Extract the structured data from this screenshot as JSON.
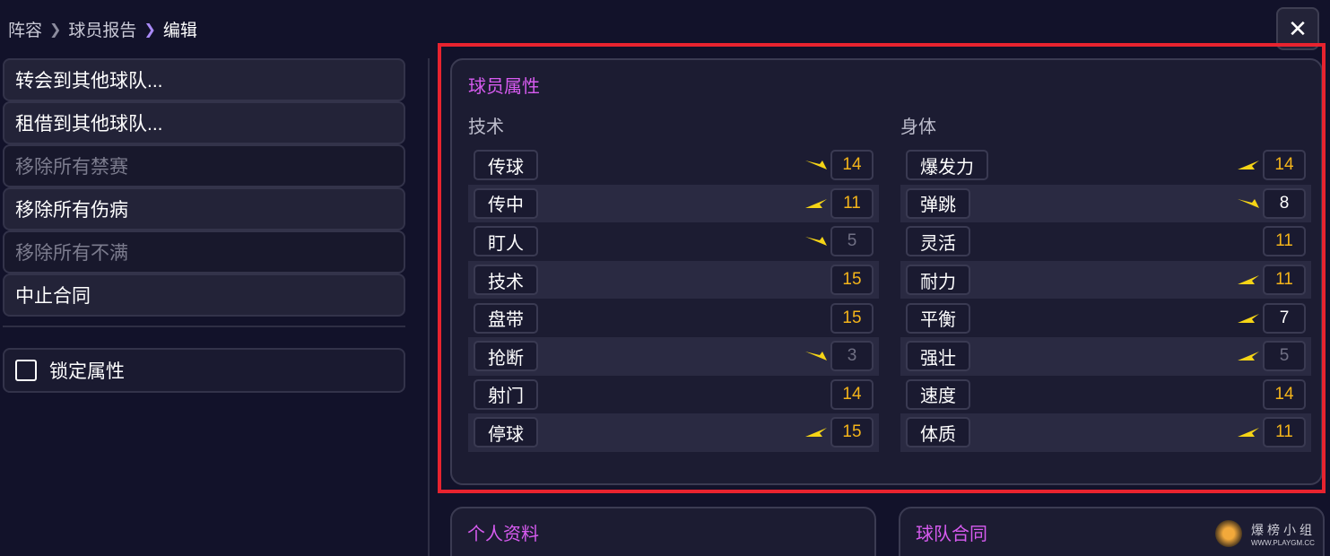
{
  "breadcrumb": {
    "items": [
      "阵容",
      "球员报告",
      "编辑"
    ]
  },
  "close_label": "✕",
  "actions": [
    {
      "label": "转会到其他球队...",
      "enabled": true
    },
    {
      "label": "租借到其他球队...",
      "enabled": true
    },
    {
      "label": "移除所有禁赛",
      "enabled": false
    },
    {
      "label": "移除所有伤病",
      "enabled": true
    },
    {
      "label": "移除所有不满",
      "enabled": false
    },
    {
      "label": "中止合同",
      "enabled": true
    }
  ],
  "lock_attributes": {
    "label": "锁定属性",
    "checked": false
  },
  "attributes_panel": {
    "title": "球员属性",
    "technical": {
      "title": "技术",
      "rows": [
        {
          "name": "传球",
          "trend": "down",
          "value": "14"
        },
        {
          "name": "传中",
          "trend": "up",
          "value": "11"
        },
        {
          "name": "盯人",
          "trend": "down",
          "value": "5"
        },
        {
          "name": "技术",
          "trend": "none",
          "value": "15"
        },
        {
          "name": "盘带",
          "trend": "none",
          "value": "15"
        },
        {
          "name": "抢断",
          "trend": "down",
          "value": "3"
        },
        {
          "name": "射门",
          "trend": "none",
          "value": "14"
        },
        {
          "name": "停球",
          "trend": "up",
          "value": "15"
        }
      ]
    },
    "physical": {
      "title": "身体",
      "rows": [
        {
          "name": "爆发力",
          "trend": "up",
          "value": "14"
        },
        {
          "name": "弹跳",
          "trend": "down",
          "value": "8"
        },
        {
          "name": "灵活",
          "trend": "none",
          "value": "11"
        },
        {
          "name": "耐力",
          "trend": "up",
          "value": "11"
        },
        {
          "name": "平衡",
          "trend": "up",
          "value": "7"
        },
        {
          "name": "强壮",
          "trend": "up",
          "value": "5"
        },
        {
          "name": "速度",
          "trend": "none",
          "value": "14"
        },
        {
          "name": "体质",
          "trend": "up",
          "value": "11"
        }
      ]
    }
  },
  "personal_panel": {
    "title": "个人资料"
  },
  "contract_panel": {
    "title": "球队合同"
  },
  "watermark": {
    "main": "爆榜小组",
    "url": "WWW.PLAYGM.CC"
  },
  "colors": {
    "accent_title": "#d75bf0",
    "value_high": "#f4b41a",
    "arrow": "#f5d416",
    "highlight": "#e8232f"
  }
}
